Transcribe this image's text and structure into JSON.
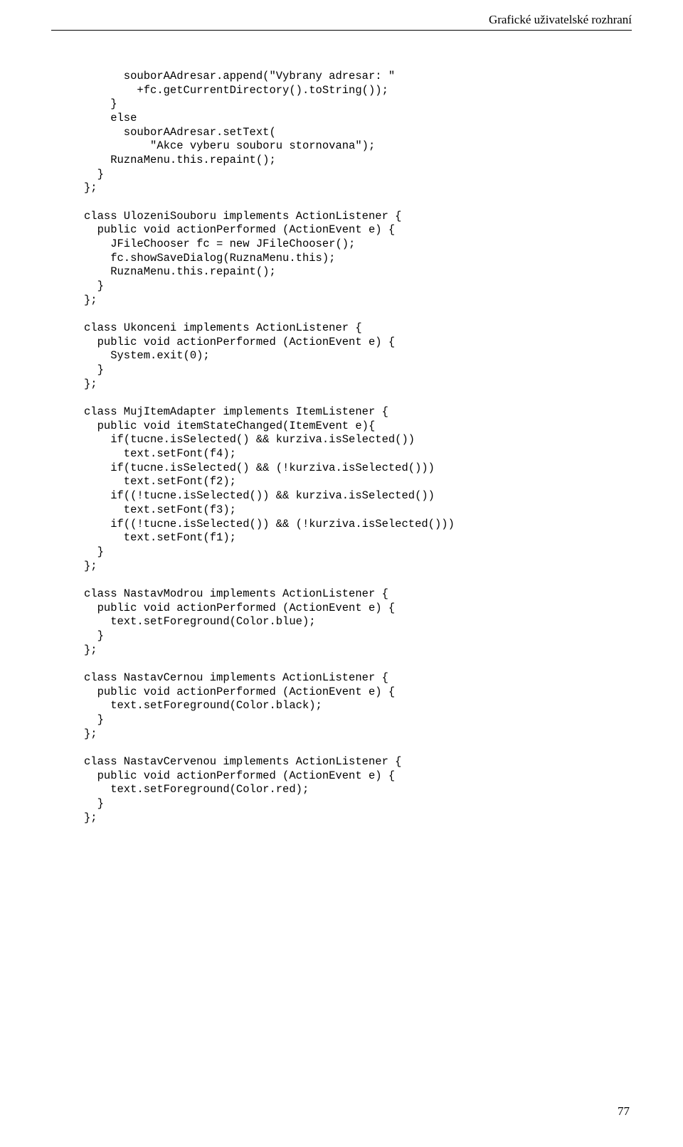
{
  "header": {
    "title": "Grafické uživatelské rozhraní"
  },
  "code": {
    "text": "      souborAAdresar.append(\"Vybrany adresar: \"\n        +fc.getCurrentDirectory().toString());\n    }\n    else\n      souborAAdresar.setText(\n          \"Akce vyberu souboru stornovana\");\n    RuznaMenu.this.repaint();\n  }\n};\n\nclass UlozeniSouboru implements ActionListener {\n  public void actionPerformed (ActionEvent e) {\n    JFileChooser fc = new JFileChooser();\n    fc.showSaveDialog(RuznaMenu.this);\n    RuznaMenu.this.repaint();\n  }\n};\n\nclass Ukonceni implements ActionListener {\n  public void actionPerformed (ActionEvent e) {\n    System.exit(0);\n  }\n};\n\nclass MujItemAdapter implements ItemListener {\n  public void itemStateChanged(ItemEvent e){\n    if(tucne.isSelected() && kurziva.isSelected())\n      text.setFont(f4);\n    if(tucne.isSelected() && (!kurziva.isSelected()))\n      text.setFont(f2);\n    if((!tucne.isSelected()) && kurziva.isSelected())\n      text.setFont(f3);\n    if((!tucne.isSelected()) && (!kurziva.isSelected()))\n      text.setFont(f1);\n  }\n};\n\nclass NastavModrou implements ActionListener {\n  public void actionPerformed (ActionEvent e) {\n    text.setForeground(Color.blue);\n  }\n};\n\nclass NastavCernou implements ActionListener {\n  public void actionPerformed (ActionEvent e) {\n    text.setForeground(Color.black);\n  }\n};\n\nclass NastavCervenou implements ActionListener {\n  public void actionPerformed (ActionEvent e) {\n    text.setForeground(Color.red);\n  }\n};"
  },
  "page": {
    "number": "77"
  }
}
